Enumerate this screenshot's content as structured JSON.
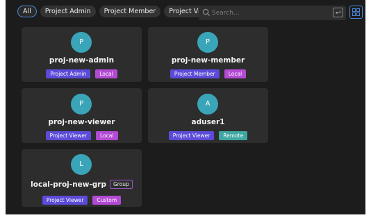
{
  "filters": [
    "All",
    "Project Admin",
    "Project Member",
    "Project Viewer"
  ],
  "search": {
    "placeholder": "Search..."
  },
  "colors": {
    "accent": "#4a86d8",
    "avatar": "#3aa5b8",
    "role_tag": "#5b4bd8",
    "local_tag": "#b24ad4",
    "remote_tag": "#3fa6a2",
    "group_border": "#9a54c9"
  },
  "icons": {
    "search": "search-icon",
    "enter": "enter-return-icon",
    "grid_view": "grid-view-icon"
  },
  "cards": [
    {
      "initial": "P",
      "name": "proj-new-admin",
      "role": "Project Admin",
      "source": "Local"
    },
    {
      "initial": "P",
      "name": "proj-new-member",
      "role": "Project Member",
      "source": "Local"
    },
    {
      "initial": "P",
      "name": "proj-new-viewer",
      "role": "Project Viewer",
      "source": "Local"
    },
    {
      "initial": "A",
      "name": "aduser1",
      "role": "Project Viewer",
      "source": "Remote"
    },
    {
      "initial": "L",
      "name": "local-proj-new-grp",
      "badge": "Group",
      "role": "Project Viewer",
      "source": "Custom"
    }
  ]
}
